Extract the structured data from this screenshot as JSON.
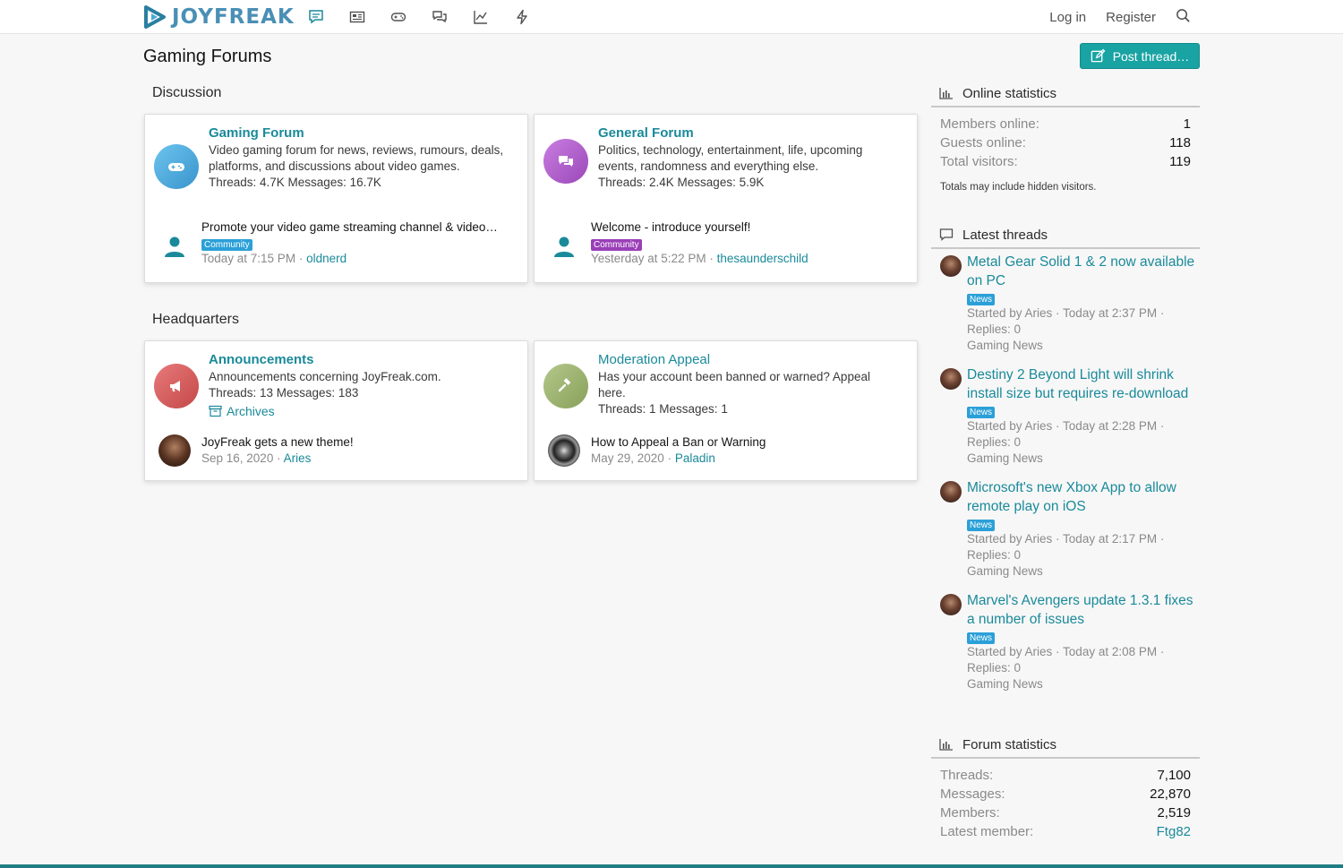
{
  "brand": {
    "name": "JOYFREAK",
    "accent": "#1aa3a3",
    "link": "#1a8a9a"
  },
  "nav": {
    "icons": [
      "forums-icon",
      "news-icon",
      "gamepad-icon",
      "chat-icon",
      "trending-icon",
      "bolt-icon"
    ],
    "login": "Log in",
    "register": "Register"
  },
  "page": {
    "title": "Gaming Forums",
    "post_thread": "Post thread…"
  },
  "sections": {
    "discussion": "Discussion",
    "headquarters": "Headquarters"
  },
  "forums": {
    "gaming": {
      "title": "Gaming Forum",
      "desc": "Video gaming forum for news, reviews, rumours, deals, platforms, and discussions about video games.",
      "meta": "Threads: 4.7K Messages: 16.7K",
      "latest_title": "Promote your video game streaming channel & video…",
      "latest_badge": "Community",
      "latest_time": "Today at 7:15 PM",
      "latest_user": "oldnerd",
      "icon_color": "#4aa8d8"
    },
    "general": {
      "title": "General Forum",
      "desc": "Politics, technology, entertainment, life, upcoming events, randomness and everything else.",
      "meta": "Threads: 2.4K Messages: 5.9K",
      "latest_title": "Welcome - introduce yourself!",
      "latest_badge": "Community",
      "latest_time": "Yesterday at 5:22 PM",
      "latest_user": "thesaunderschild",
      "icon_color": "#b05fc8"
    },
    "announcements": {
      "title": "Announcements",
      "desc": "Announcements concerning JoyFreak.com.",
      "meta": "Threads: 13 Messages: 183",
      "subforum": "Archives",
      "latest_title": "JoyFreak gets a new theme!",
      "latest_time": "Sep 16, 2020",
      "latest_user": "Aries",
      "icon_color": "#d75a5a"
    },
    "moderation": {
      "title": "Moderation Appeal",
      "desc": "Has your account been banned or warned? Appeal here.",
      "meta": "Threads: 1 Messages: 1",
      "latest_title": "How to Appeal a Ban or Warning",
      "latest_time": "May 29, 2020",
      "latest_user": "Paladin",
      "icon_color": "#9ab06a"
    }
  },
  "sidebar": {
    "online": {
      "title": "Online statistics",
      "rows": [
        {
          "label": "Members online:",
          "value": "1"
        },
        {
          "label": "Guests online:",
          "value": "118"
        },
        {
          "label": "Total visitors:",
          "value": "119"
        }
      ],
      "note": "Totals may include hidden visitors."
    },
    "latest": {
      "title": "Latest threads",
      "threads": [
        {
          "title": "Metal Gear Solid 1 & 2 now available on PC",
          "badge": "News",
          "started": "Started by Aries · Today at 2:37 PM ·",
          "replies": "Replies: 0",
          "forum": "Gaming News"
        },
        {
          "title": "Destiny 2 Beyond Light will shrink install size but requires re-download",
          "badge": "News",
          "started": "Started by Aries · Today at 2:28 PM ·",
          "replies": "Replies: 0",
          "forum": "Gaming News"
        },
        {
          "title": "Microsoft's new Xbox App to allow remote play on iOS",
          "badge": "News",
          "started": "Started by Aries · Today at 2:17 PM ·",
          "replies": "Replies: 0",
          "forum": "Gaming News"
        },
        {
          "title": "Marvel's Avengers update 1.3.1 fixes a number of issues",
          "badge": "News",
          "started": "Started by Aries · Today at 2:08 PM ·",
          "replies": "Replies: 0",
          "forum": "Gaming News"
        }
      ]
    },
    "forum_stats": {
      "title": "Forum statistics",
      "rows": [
        {
          "label": "Threads:",
          "value": "7,100"
        },
        {
          "label": "Messages:",
          "value": "22,870"
        },
        {
          "label": "Members:",
          "value": "2,519"
        },
        {
          "label": "Latest member:",
          "value": "Ftg82"
        }
      ]
    }
  }
}
